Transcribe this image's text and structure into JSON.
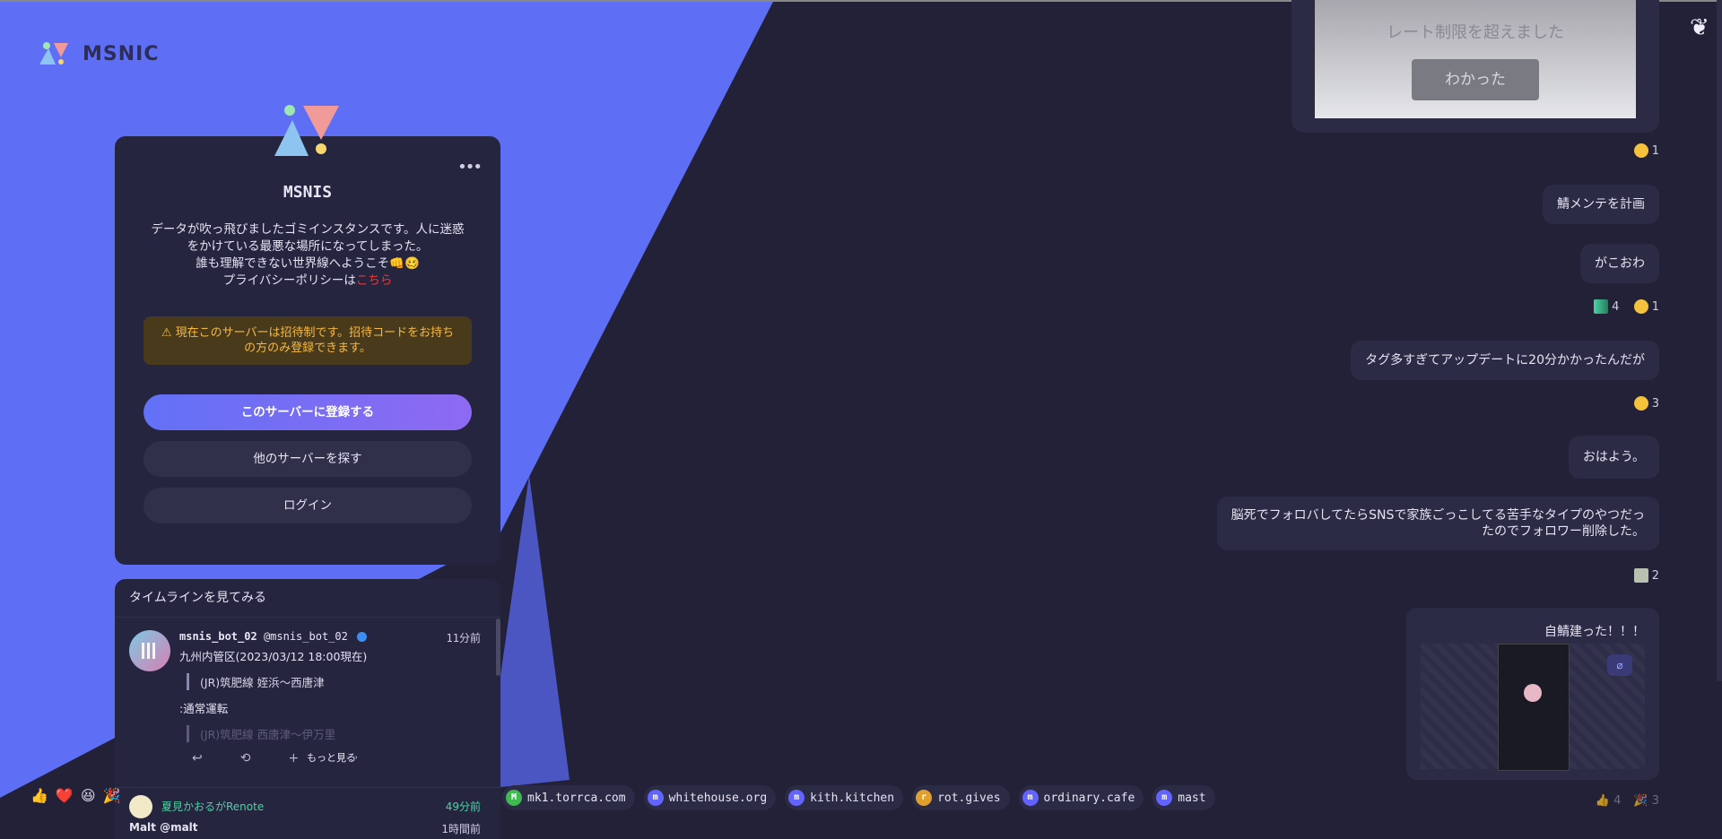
{
  "brand": {
    "name": "MSNIC"
  },
  "card": {
    "more": "•••",
    "title": "MSNIS",
    "desc_line1": "データが吹っ飛びましたゴミインスタンスです。人に迷惑",
    "desc_line2": "をかけている最悪な場所になってしまった。",
    "desc_line3": "誰も理解できない世界線へようこそ👊🥴",
    "desc_line4_prefix": "プライバシーポリシーは",
    "desc_line4_link": "こちら",
    "notice": "⚠ 現在このサーバーは招待制です。招待コードをお持ちの方のみ登録できます。",
    "btn_signup": "このサーバーに登録する",
    "btn_explore": "他のサーバーを探す",
    "btn_login": "ログイン"
  },
  "timeline": {
    "header": "タイムラインを見てみる",
    "note": {
      "name": "msnis_bot_02",
      "handle": "@msnis_bot_02",
      "time": "11分前",
      "line1": "九州内管区(2023/03/12 18:00現在)",
      "quote1": "(JR)筑肥線 姪浜～西唐津",
      "status": ":通常運転",
      "quote2": "(JR)筑肥線 西唐津～伊万里",
      "see_more": "もっと見る",
      "actions": {
        "reply": "↩",
        "renote": "⟲",
        "react": "+",
        "more": "•••"
      }
    },
    "renote": {
      "text": "夏見かおるがRenote",
      "time": "49分前"
    },
    "next": {
      "name": "Malt @malt",
      "time": "1時間前"
    }
  },
  "bottom_reactions": [
    "👍",
    "❤️",
    "😆",
    "🎉"
  ],
  "ticker": [
    {
      "icon": "M",
      "label": "mk1.torrca.com",
      "color": "#3fb950"
    },
    {
      "icon": "m",
      "label": "whitehouse.org",
      "color": "#6364ff"
    },
    {
      "icon": "m",
      "label": "kith.kitchen",
      "color": "#6364ff"
    },
    {
      "icon": "r",
      "label": "rot.gives",
      "color": "#e0a030"
    },
    {
      "icon": "m",
      "label": "ordinary.cafe",
      "color": "#6364ff"
    },
    {
      "icon": "m",
      "label": "mast",
      "color": "#6364ff"
    }
  ],
  "right": {
    "rate_text": "レート制限を超えました",
    "rate_btn": "わかった",
    "r1": "1",
    "m1": "鯖メンテを計画",
    "m2": "がこおわ",
    "r2a": "4",
    "r2b": "1",
    "m3": "タグ多すぎてアップデートに20分かかったんだが",
    "r3": "3",
    "m4": "おはよう。",
    "m5_line1": "脳死でフォロバしてたらSNSで家族ごっこしてる苦手なタイプのやつだっ",
    "m5_line2": "たのでフォロワー削除した。",
    "r5": "2",
    "m6": "自鯖建った！！！",
    "hide_icon": "eye-slash",
    "bottom_r1": "4",
    "bottom_r2": "3"
  }
}
